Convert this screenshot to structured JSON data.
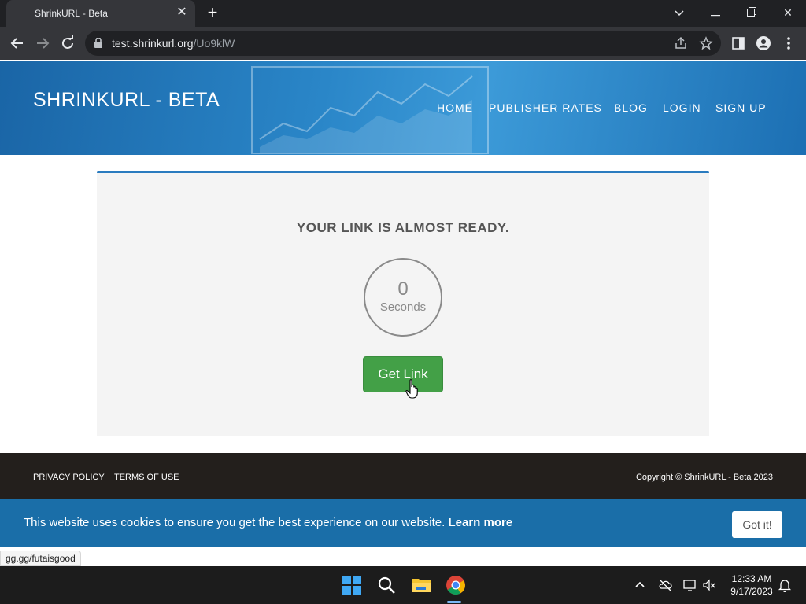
{
  "browser": {
    "tab_title": "ShrinkURL - Beta",
    "url_host": "test.shrinkurl.org",
    "url_path": "/Uo9klW"
  },
  "header": {
    "brand": "SHRINKURL - BETA",
    "nav": [
      "HOME",
      "PUBLISHER RATES",
      "BLOG",
      "LOGIN",
      "SIGN UP"
    ]
  },
  "main": {
    "heading": "YOUR LINK IS ALMOST READY.",
    "counter_value": "0",
    "counter_label": "Seconds",
    "button_label": "Get Link"
  },
  "footer": {
    "links": [
      "PRIVACY POLICY",
      "TERMS OF USE"
    ],
    "copyright": "Copyright © ShrinkURL - Beta 2023"
  },
  "cookie_banner": {
    "message": "This website uses cookies to ensure you get the best experience on our website.",
    "learn_more": "Learn more",
    "button": "Got it!"
  },
  "status_bar": {
    "hover_url": "gg.gg/futaisgood"
  },
  "taskbar": {
    "time": "12:33 AM",
    "date": "9/17/2023"
  },
  "colors": {
    "header_blue": "#2a86c8",
    "button_green": "#43a047",
    "cookie_blue": "#1a6ea8",
    "footer_dark": "#231f1c"
  }
}
